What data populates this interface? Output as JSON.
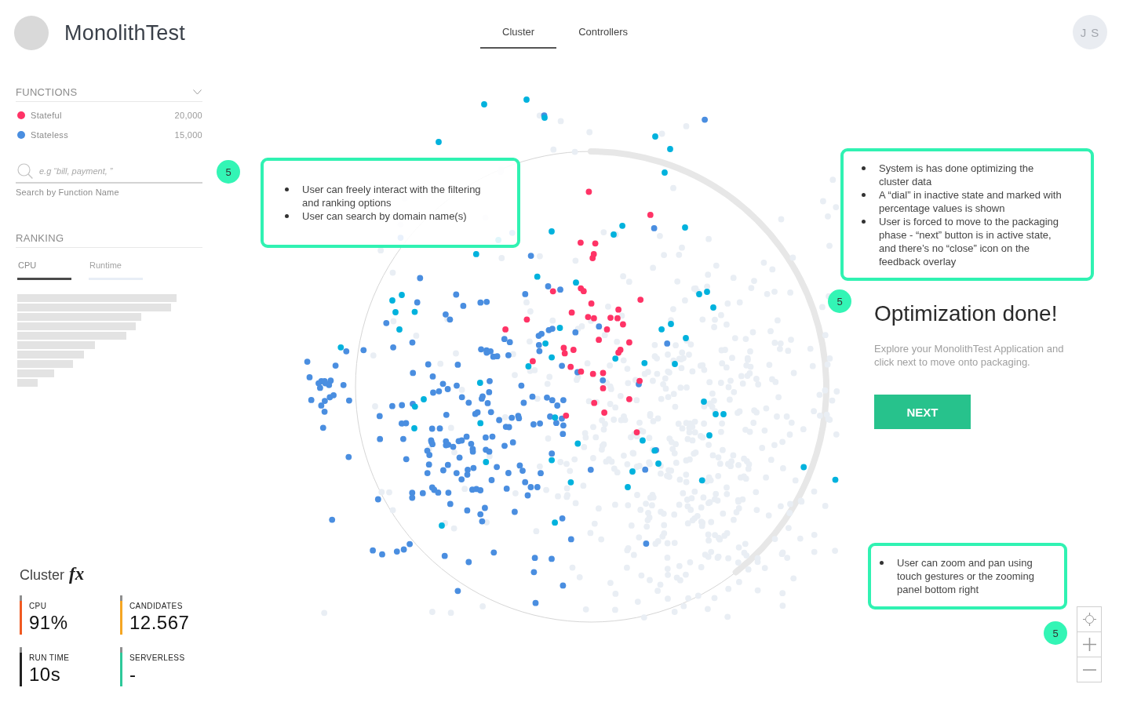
{
  "header": {
    "app_title": "MonolithTest",
    "tabs": [
      {
        "label": "Cluster",
        "selected": true
      },
      {
        "label": "Controllers",
        "selected": false
      }
    ],
    "user_initials": "J S"
  },
  "sidebar": {
    "functions": {
      "title": "FUNCTIONS",
      "items": [
        {
          "label": "Stateful",
          "count": "20,000",
          "color": "#ff3366"
        },
        {
          "label": "Stateless",
          "count": "15,000",
          "color": "#4a8ee0"
        }
      ]
    },
    "search": {
      "placeholder": "e.g “bill, payment, ”",
      "helper": "Search by Function Name"
    },
    "ranking": {
      "title": "RANKING",
      "tabs": [
        {
          "label": "CPU",
          "selected": true
        },
        {
          "label": "Runtime",
          "selected": false
        }
      ]
    },
    "cluster_stats": {
      "title": "Cluster",
      "mark": "fx",
      "stats": [
        {
          "label": "CPU",
          "value": "91%",
          "color": "#f05a22"
        },
        {
          "label": "CANDIDATES",
          "value": "12.567",
          "color": "#f5a623"
        },
        {
          "label": "RUN TIME",
          "value": "10s",
          "color": "#222222"
        },
        {
          "label": "SERVERLESS",
          "value": "-",
          "color": "#2ec99a"
        }
      ]
    }
  },
  "annotations": [
    {
      "badge": "5",
      "bullets": [
        "User can freely interact with the filtering and ranking options",
        "User can search by domain name(s)"
      ]
    },
    {
      "badge": "5",
      "bullets": [
        "System is has done optimizing the cluster data",
        "A “dial” in inactive state and marked with percentage values is shown",
        "User is forced to move to the packaging phase - “next” button is in active state, and there’s no “close” icon on the feedback overlay"
      ]
    },
    {
      "badge": "5",
      "bullets": [
        "User can zoom and pan using touch gestures or the zooming panel bottom right"
      ]
    }
  ],
  "result_panel": {
    "title": "Optimization done!",
    "description": "Explore your MonolithTest Application and click next to move onto packaging.",
    "button": "NEXT"
  }
}
